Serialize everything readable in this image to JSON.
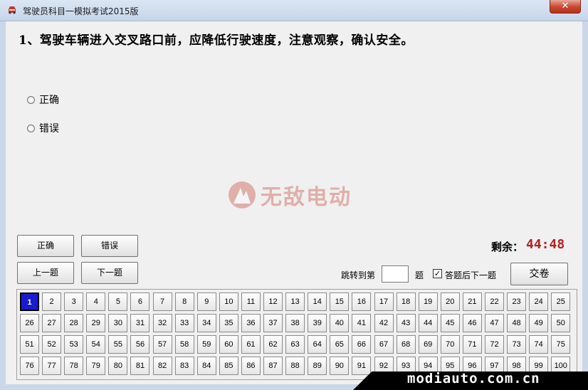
{
  "window": {
    "title": "驾驶员科目一模拟考试2015版",
    "close_label": "✕"
  },
  "question": {
    "text": "1、驾驶车辆进入交叉路口前，应降低行驶速度，注意观察，确认安全。"
  },
  "options": [
    "正确",
    "错误"
  ],
  "watermark": {
    "text": "无敌电动"
  },
  "buttons": {
    "correct": "正确",
    "wrong": "错误",
    "prev": "上一题",
    "next": "下一题",
    "submit": "交卷"
  },
  "timer": {
    "label": "剩余：",
    "value": "44:48"
  },
  "jump": {
    "label": "跳转到第",
    "value": "",
    "suffix": "题"
  },
  "auto_next": {
    "label": "答题后下一题",
    "checked": true
  },
  "question_grid": {
    "current": 1,
    "numbers": [
      "1",
      "2",
      "3",
      "4",
      "5",
      "6",
      "7",
      "8",
      "9",
      "10",
      "11",
      "12",
      "13",
      "14",
      "15",
      "16",
      "17",
      "18",
      "19",
      "20",
      "21",
      "22",
      "23",
      "24",
      "25",
      "26",
      "27",
      "28",
      "29",
      "30",
      "31",
      "32",
      "33",
      "34",
      "35",
      "36",
      "37",
      "38",
      "39",
      "40",
      "41",
      "42",
      "43",
      "44",
      "45",
      "46",
      "47",
      "48",
      "49",
      "50",
      "51",
      "52",
      "53",
      "54",
      "55",
      "56",
      "57",
      "58",
      "59",
      "60",
      "61",
      "62",
      "63",
      "64",
      "65",
      "66",
      "67",
      "68",
      "69",
      "70",
      "71",
      "72",
      "73",
      "74",
      "75",
      "76",
      "77",
      "78",
      "79",
      "80",
      "81",
      "82",
      "83",
      "84",
      "85",
      "86",
      "87",
      "88",
      "89",
      "90",
      "91",
      "92",
      "93",
      "94",
      "95",
      "96",
      "97",
      "98",
      "99",
      "100"
    ]
  },
  "banner": {
    "text": "modiauto.com.cn"
  },
  "colors": {
    "timer": "#b22222",
    "current_cell": "#1a1ad0",
    "close": "#c7472f"
  }
}
